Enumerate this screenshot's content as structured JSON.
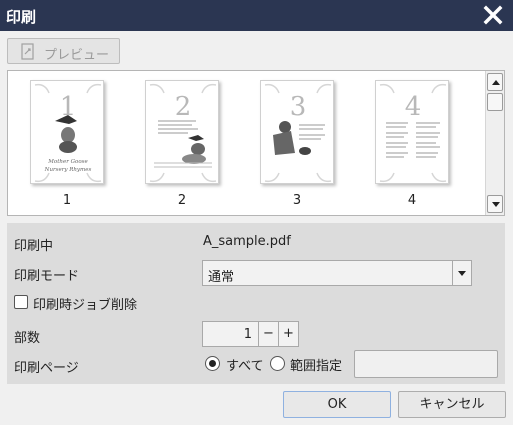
{
  "titlebar": {
    "title": "印刷",
    "close_icon": "close-icon"
  },
  "toolbar": {
    "preview_label": "プレビュー",
    "preview_icon": "preview-page-icon"
  },
  "thumbnails": [
    {
      "page": "1",
      "digit": "1",
      "label": "1",
      "caption_line1": "Mother Goose",
      "caption_line2": "Nursery Rhymes"
    },
    {
      "page": "2",
      "digit": "2",
      "label": "2"
    },
    {
      "page": "3",
      "digit": "3",
      "label": "3"
    },
    {
      "page": "4",
      "digit": "4",
      "label": "4"
    }
  ],
  "settings": {
    "printing_label": "印刷中",
    "printing_value": "A_sample.pdf",
    "mode_label": "印刷モード",
    "mode_value": "通常",
    "delete_job_label": "印刷時ジョブ削除",
    "delete_job_checked": false,
    "copies_label": "部数",
    "copies_value": "1",
    "copies_minus": "−",
    "copies_plus": "+",
    "pages_label": "印刷ページ",
    "pages_all_label": "すべて",
    "pages_range_label": "範囲指定",
    "pages_selected": "all",
    "pages_range_value": ""
  },
  "footer": {
    "ok_label": "OK",
    "cancel_label": "キャンセル"
  },
  "colors": {
    "titlebar": "#2b3652",
    "panel": "#dcdcdc",
    "background": "#f0f0f0"
  }
}
